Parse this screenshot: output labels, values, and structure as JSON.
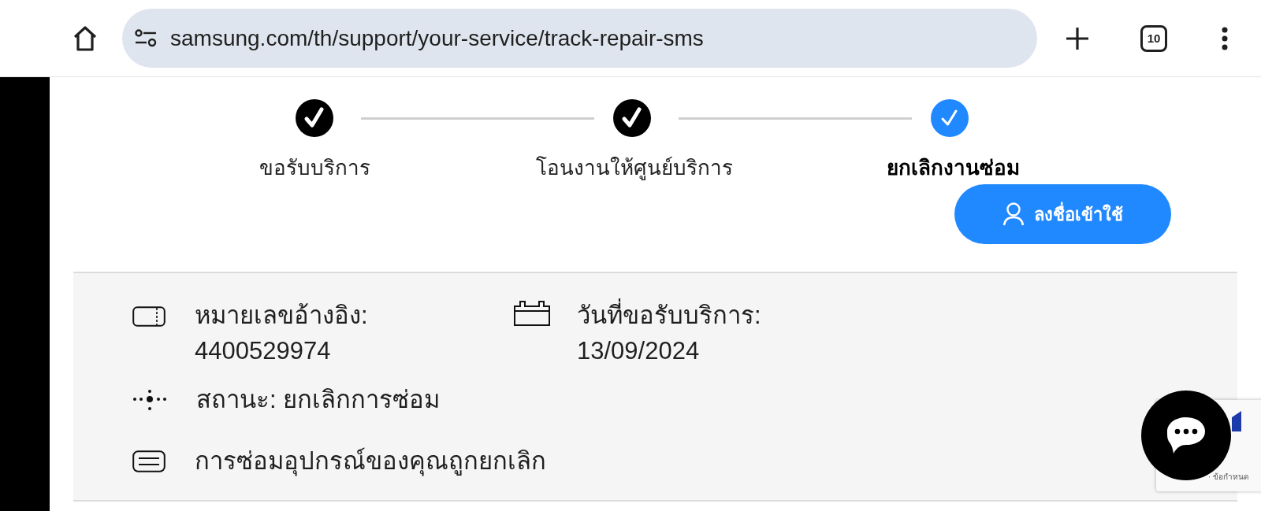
{
  "browser": {
    "url": "samsung.com/th/support/your-service/track-repair-sms",
    "tab_count": "10"
  },
  "stepper": [
    {
      "label": "ขอรับบริการ",
      "selected": false
    },
    {
      "label": "โอนงานให้ศูนย์บริการ",
      "selected": false
    },
    {
      "label": "ยกเลิกงานซ่อม",
      "selected": true
    }
  ],
  "login_button": {
    "label": "ลงชื่อเข้าใช้"
  },
  "details": {
    "fields": [
      {
        "kind": "reference",
        "label": "หมายเลขอ้างอิง:",
        "value": "4400529974"
      },
      {
        "kind": "date",
        "label": "วันที่ขอรับบริการ:",
        "value": "13/09/2024"
      }
    ],
    "rows": [
      {
        "kind": "status",
        "text": "สถานะ: ยกเลิกการซ่อม"
      },
      {
        "kind": "message",
        "text": "การซ่อมอุปกรณ์ของคุณถูกยกเลิก"
      }
    ]
  },
  "recaptcha": {
    "terms": "· ข้อกำหนด"
  }
}
